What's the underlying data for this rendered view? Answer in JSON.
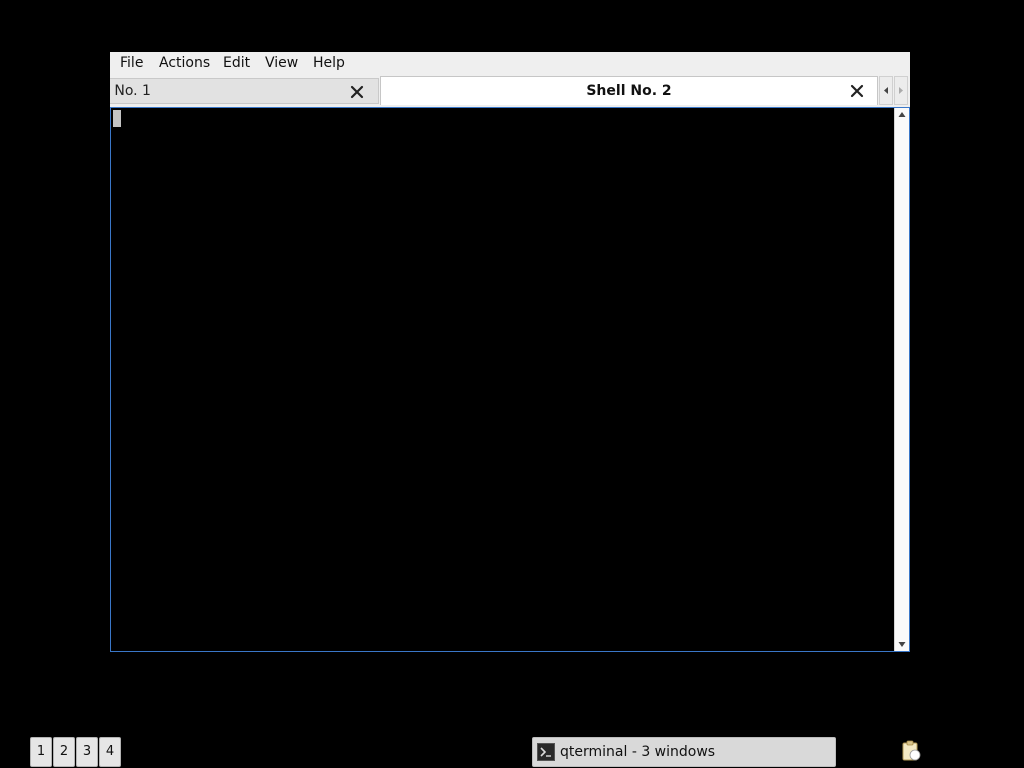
{
  "window": {
    "menu": [
      "File",
      "Actions",
      "Edit",
      "View",
      "Help"
    ],
    "tabs": [
      {
        "label": "l No. 1",
        "active": false
      },
      {
        "label": "Shell No. 2",
        "active": true
      }
    ],
    "border_color": "#3a77c8"
  },
  "panel": {
    "desktops": [
      "1",
      "2",
      "3",
      "4"
    ],
    "task": {
      "label": "qterminal - 3 windows",
      "icon": "terminal-icon"
    },
    "tray": {
      "icon": "clipboard-icon"
    }
  }
}
